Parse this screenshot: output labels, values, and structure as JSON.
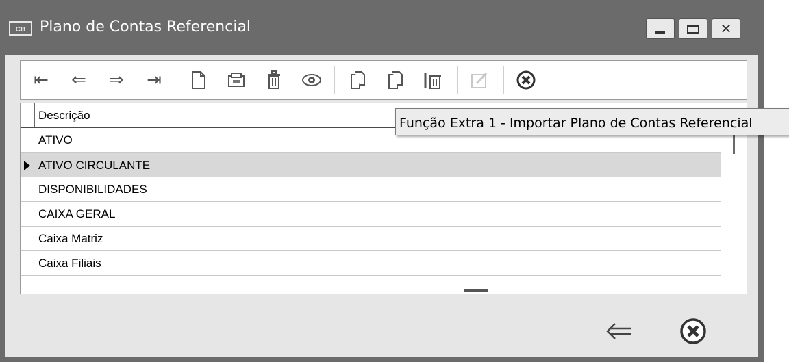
{
  "window": {
    "app_icon_text": "CB",
    "title": "Plano de Contas Referencial",
    "controls": {
      "minimize_icon": "minimize-icon",
      "maximize_icon": "maximize-icon",
      "close_icon": "close-icon"
    }
  },
  "toolbar": {
    "buttons": [
      {
        "name": "first-record-button",
        "icon": "first-icon",
        "glyph": "⇤"
      },
      {
        "name": "previous-record-button",
        "icon": "previous-icon",
        "glyph": "⇐"
      },
      {
        "name": "next-record-button",
        "icon": "next-icon",
        "glyph": "⇒"
      },
      {
        "name": "last-record-button",
        "icon": "last-icon",
        "glyph": "⇥"
      },
      {
        "name": "new-record-button",
        "icon": "new-document-icon",
        "glyph": "🗋"
      },
      {
        "name": "edit-record-button",
        "icon": "edit-tray-icon",
        "glyph": "🗃"
      },
      {
        "name": "delete-record-button",
        "icon": "trash-icon",
        "glyph": "🗑"
      },
      {
        "name": "view-record-button",
        "icon": "eye-icon",
        "glyph": "👁"
      },
      {
        "name": "extra-function-1-button",
        "icon": "copy-document-icon",
        "glyph": "🗐"
      },
      {
        "name": "extra-function-2-button",
        "icon": "copy-document-icon",
        "glyph": "🗐"
      },
      {
        "name": "extra-function-3-button",
        "icon": "trash-bin-icon",
        "glyph": "🗑"
      },
      {
        "name": "edit-note-button",
        "icon": "edit-pencil-icon",
        "glyph": "✎"
      },
      {
        "name": "close-toolbar-button",
        "icon": "close-circle-icon",
        "glyph": "✖"
      }
    ]
  },
  "grid": {
    "column_header": "Descrição",
    "rows": [
      "ATIVO",
      "ATIVO CIRCULANTE",
      "DISPONIBILIDADES",
      "CAIXA GERAL",
      "Caixa Matriz",
      "Caixa Filiais"
    ],
    "selected_index": 1
  },
  "tooltip": {
    "text": "Função Extra 1 - Importar Plano de Contas Referencial"
  },
  "bottom": {
    "back_icon": "back-arrow-icon",
    "close_icon": "close-circle-icon"
  },
  "colors": {
    "titlebar": "#6b6b6b",
    "panel": "#e6e6e6",
    "selected_row": "#d8d8d8"
  }
}
